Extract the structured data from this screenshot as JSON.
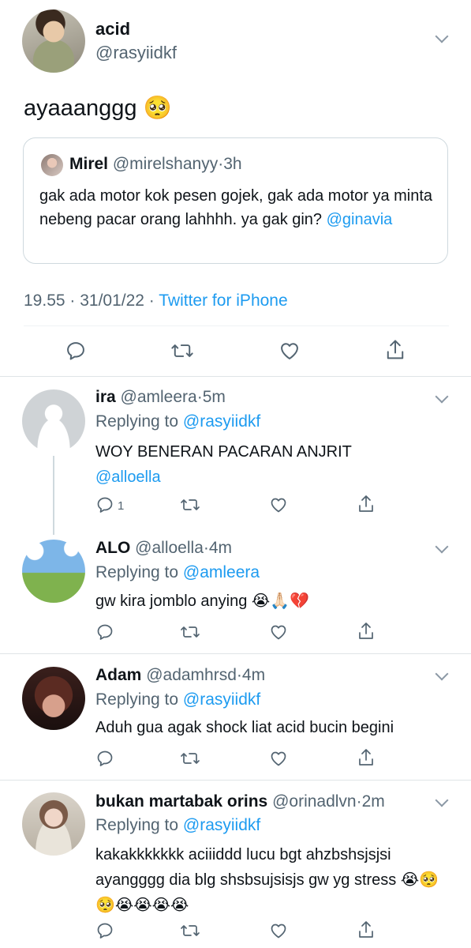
{
  "main_tweet": {
    "name": "acid",
    "handle": "@rasyiidkf",
    "text": "ayaaanggg 🥺",
    "quote": {
      "name": "Mirel",
      "handle": "@mirelshanyy",
      "separator": "·",
      "time": "3h",
      "text": "gak ada motor kok pesen gojek, gak ada motor ya minta nebeng pacar orang lahhhh. ya gak gin?",
      "mention": "@ginavia"
    },
    "timestamp": "19.55 · 31/01/22 · ",
    "source": "Twitter for iPhone"
  },
  "replies": [
    {
      "name": "ira",
      "handle": "@amleera",
      "separator": "·",
      "time": "5m",
      "replying_label": "Replying to ",
      "replying_to": "@rasyiidkf",
      "text": "WOY BENERAN PACARAN ANJRIT",
      "mention": "@alloella",
      "reply_count": "1"
    },
    {
      "name": "ALO",
      "handle": "@alloella",
      "separator": "·",
      "time": "4m",
      "replying_label": "Replying to ",
      "replying_to": "@amleera",
      "text": "gw kira jomblo anying 😭🙏🏻💔"
    },
    {
      "name": "Adam",
      "handle": "@adamhrsd",
      "separator": "·",
      "time": "4m",
      "replying_label": "Replying to ",
      "replying_to": "@rasyiidkf",
      "text": "Aduh gua agak shock liat acid bucin begini"
    },
    {
      "name": "bukan martabak orins",
      "handle": "@orinadlvn",
      "separator": "·",
      "time": "2m",
      "replying_label": "Replying to ",
      "replying_to": "@rasyiidkf",
      "text": "kakakkkkkkk aciiiddd lucu bgt ahzbshsjsjsi ayangggg dia blg shsbsujsisjs gw yg stress 😭🥺🥺😭😭😭😭"
    }
  ],
  "icons": {
    "reply": "reply-icon",
    "retweet": "retweet-icon",
    "like": "like-icon",
    "share": "share-icon",
    "more": "chevron-down-icon"
  },
  "colors": {
    "link": "#1d9bf0",
    "muted": "#536471",
    "text": "#0f1419",
    "divider": "#dfe4e7"
  }
}
